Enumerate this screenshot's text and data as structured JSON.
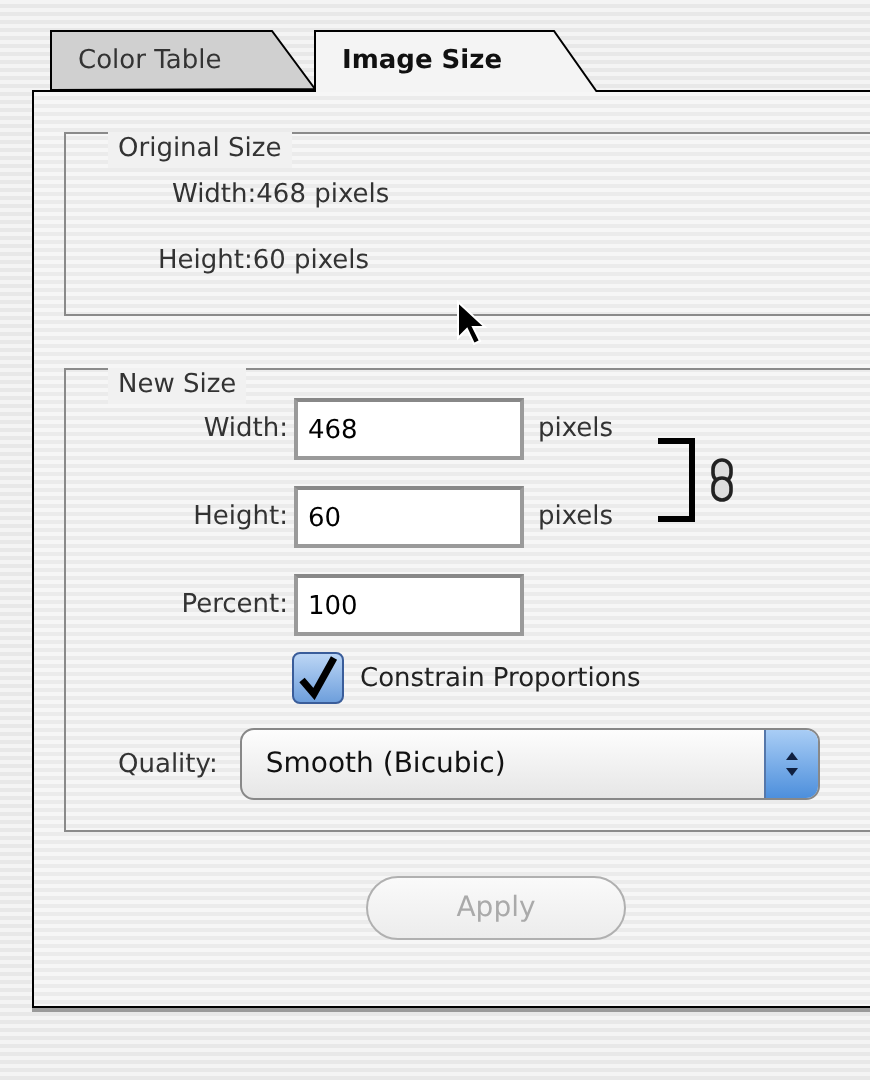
{
  "tabs": [
    {
      "label": "Color Table",
      "selected": false
    },
    {
      "label": "Image Size",
      "selected": true
    }
  ],
  "original_size": {
    "title": "Original Size",
    "width": "Width:468 pixels",
    "height": "Height:60 pixels"
  },
  "new_size": {
    "title": "New Size",
    "fields": [
      {
        "label": "Width:",
        "value": "468",
        "unit": "pixels"
      },
      {
        "label": "Height:",
        "value": "60",
        "unit": "pixels"
      },
      {
        "label": "Percent:",
        "value": "100"
      }
    ],
    "constrain_proportions": {
      "label": "Constrain Proportions",
      "checked": true
    },
    "quality": {
      "label": "Quality:",
      "value": "Smooth (Bicubic)"
    }
  },
  "apply_button": {
    "label": "Apply",
    "disabled": true
  }
}
